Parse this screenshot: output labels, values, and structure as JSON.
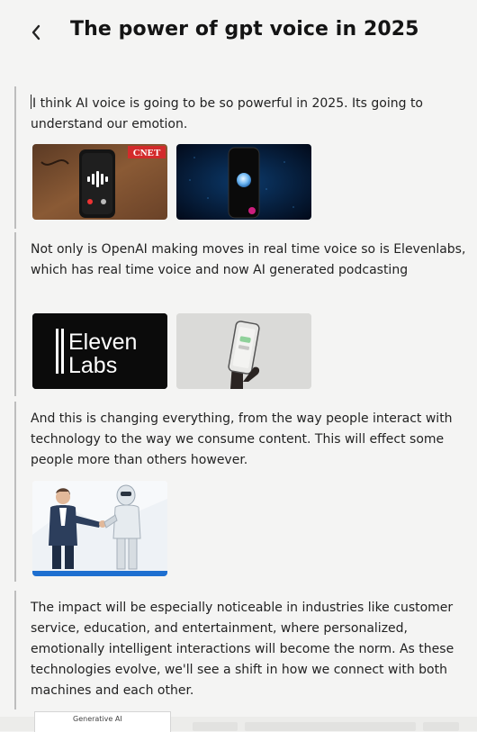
{
  "header": {
    "title": "The power of gpt voice in 2025"
  },
  "blocks": [
    {
      "text": "I think AI voice is going to be so powerful in 2025. Its going to understand our emotion.",
      "images": [
        {
          "name": "phone-voice-recording-image",
          "badge": "CNET"
        },
        {
          "name": "phone-blue-orb-image"
        }
      ]
    },
    {
      "text": "Not only is OpenAI making moves in real time voice so is Elevenlabs, which has real time voice and now AI generated podcasting",
      "images": [
        {
          "name": "elevenlabs-logo-image",
          "logo_line1": "Eleven",
          "logo_line2": "Labs"
        },
        {
          "name": "hand-holding-phone-image"
        }
      ]
    },
    {
      "text": "And this is changing everything, from the way people interact with technology to the way we consume content. This will effect some people more than others however.",
      "images": [
        {
          "name": "man-handshake-robot-image"
        }
      ]
    },
    {
      "text": "The impact will be especially noticeable in industries like customer service, education, and entertainment, where personalized, emotionally intelligent interactions will become the norm. As these technologies evolve, we'll see a shift in how we connect with both machines and each other.",
      "images": []
    }
  ],
  "footer": {
    "card_label": "Generative AI"
  },
  "colors": {
    "background": "#f4f4f3",
    "divider": "#bdbdbd",
    "elevenlabs_bg": "#0b0b0b",
    "cnet_red": "#d32b2b"
  }
}
